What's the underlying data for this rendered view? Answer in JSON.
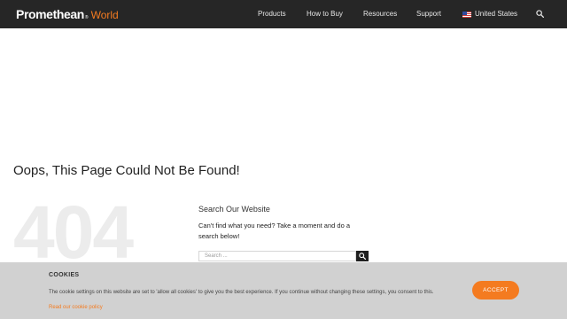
{
  "header": {
    "logo_main": "Promethean",
    "logo_reg": "®",
    "logo_sub": "World",
    "nav": [
      {
        "label": "Products"
      },
      {
        "label": "How to Buy"
      },
      {
        "label": "Resources"
      },
      {
        "label": "Support"
      }
    ],
    "region": "United States",
    "search_icon": "search-icon"
  },
  "main": {
    "title": "Oops, This Page Could Not Be Found!",
    "error_code": "404",
    "widget_title": "Search Our Website",
    "widget_text": "Can't find what you need? Take a moment and do a search below!",
    "search_placeholder": "Search ..."
  },
  "cookie": {
    "title": "COOKIES",
    "text": "The cookie settings on this website are set to 'allow all cookies' to give you the best experience. If you continue without changing these settings, you consent to this.",
    "link": "Read our cookie policy",
    "accept": "ACCEPT"
  },
  "colors": {
    "accent": "#f47b20",
    "header_bg": "#262626"
  }
}
